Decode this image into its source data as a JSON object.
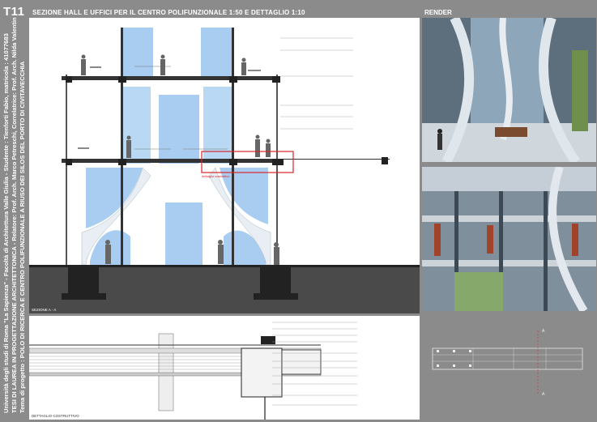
{
  "board": {
    "code": "T11",
    "title": "SEZIONE HALL E UFFICI PER IL CENTRO POLIFUNZIONALE 1:50 E DETTAGLIO 1:10",
    "render_title": "RENDER",
    "vertical_lines": [
      "Università degli studi di Roma \"La Sapienza\" - Facoltà di Architettura Valle Giulia - Studente : Tienforti Fabio, matricola : 41077683",
      "TESI DI LAUREA IN PROGETTAZIONE ARCHITETTONICA - Relatore: Prof. Arch. Marco Petreschi, Correlatrice: Prof. Arch. Nilda Valentin",
      "Tema di progetto : POLO DI RICERCA E CENTRO POLIFUNZIONALE A RIUSO DEI SILOS DEL PORTO DI CIVITAVECCHIA"
    ]
  },
  "section": {
    "label": "SEZIONE A - A",
    "detail_tag": "dettaglio costruttivo"
  },
  "detail": {
    "label": "DETTAGLIO COSTRUTTIVO"
  },
  "plan": {
    "marker_a": "A"
  },
  "colors": {
    "board_gray": "#8b8b8b",
    "glass_blue": "#a8cdf0",
    "highlight_red": "#d9232d"
  }
}
